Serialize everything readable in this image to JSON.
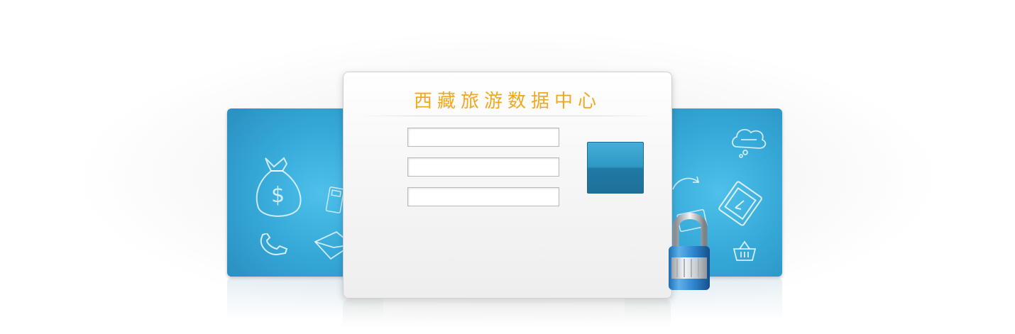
{
  "login": {
    "title": "西藏旅游数据中心",
    "username": {
      "value": "",
      "placeholder": ""
    },
    "password": {
      "value": "",
      "placeholder": ""
    },
    "captcha": {
      "value": "",
      "placeholder": ""
    },
    "submit_label": ""
  },
  "colors": {
    "title": "#f2a81e",
    "panel": "#34a6d6",
    "button": "#2e97c4"
  },
  "icons": {
    "left_panel": [
      "money-bag-icon",
      "calculator-icon",
      "phone-icon",
      "envelope-icon"
    ],
    "right_panel": [
      "chat-cloud-icon",
      "tablet-icon",
      "arrow-icon",
      "basket-icon",
      "credit-card-icon"
    ],
    "lock": "padlock-icon"
  }
}
